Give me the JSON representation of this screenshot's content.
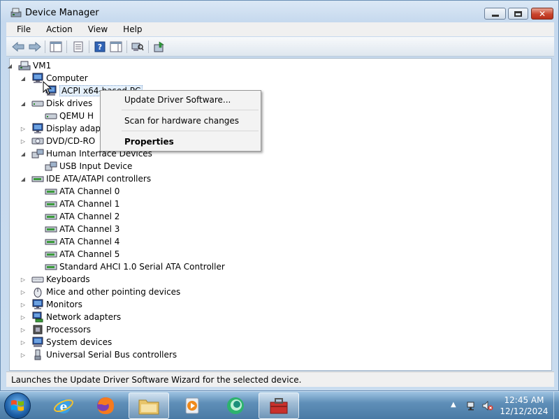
{
  "window": {
    "title": "Device Manager"
  },
  "menu": [
    "File",
    "Action",
    "View",
    "Help"
  ],
  "tree": {
    "root": "VM1",
    "nodes": [
      {
        "label": "Computer"
      },
      {
        "label": "ACPI x64-based PC"
      },
      {
        "label": "Disk drives"
      },
      {
        "label": "QEMU H"
      },
      {
        "label": "Display adap"
      },
      {
        "label": "DVD/CD-RO"
      },
      {
        "label": "Human Interface Devices"
      },
      {
        "label": "USB Input Device"
      },
      {
        "label": "IDE ATA/ATAPI controllers"
      },
      {
        "label": "ATA Channel 0"
      },
      {
        "label": "ATA Channel 1"
      },
      {
        "label": "ATA Channel 2"
      },
      {
        "label": "ATA Channel 3"
      },
      {
        "label": "ATA Channel 4"
      },
      {
        "label": "ATA Channel 5"
      },
      {
        "label": "Standard AHCI 1.0 Serial ATA Controller"
      },
      {
        "label": "Keyboards"
      },
      {
        "label": "Mice and other pointing devices"
      },
      {
        "label": "Monitors"
      },
      {
        "label": "Network adapters"
      },
      {
        "label": "Processors"
      },
      {
        "label": "System devices"
      },
      {
        "label": "Universal Serial Bus controllers"
      }
    ]
  },
  "context_menu": {
    "update": "Update Driver Software...",
    "scan": "Scan for hardware changes",
    "properties": "Properties"
  },
  "status": "Launches the Update Driver Software Wizard for the selected device.",
  "clock": {
    "time": "12:45 AM",
    "date": "12/12/2024"
  }
}
